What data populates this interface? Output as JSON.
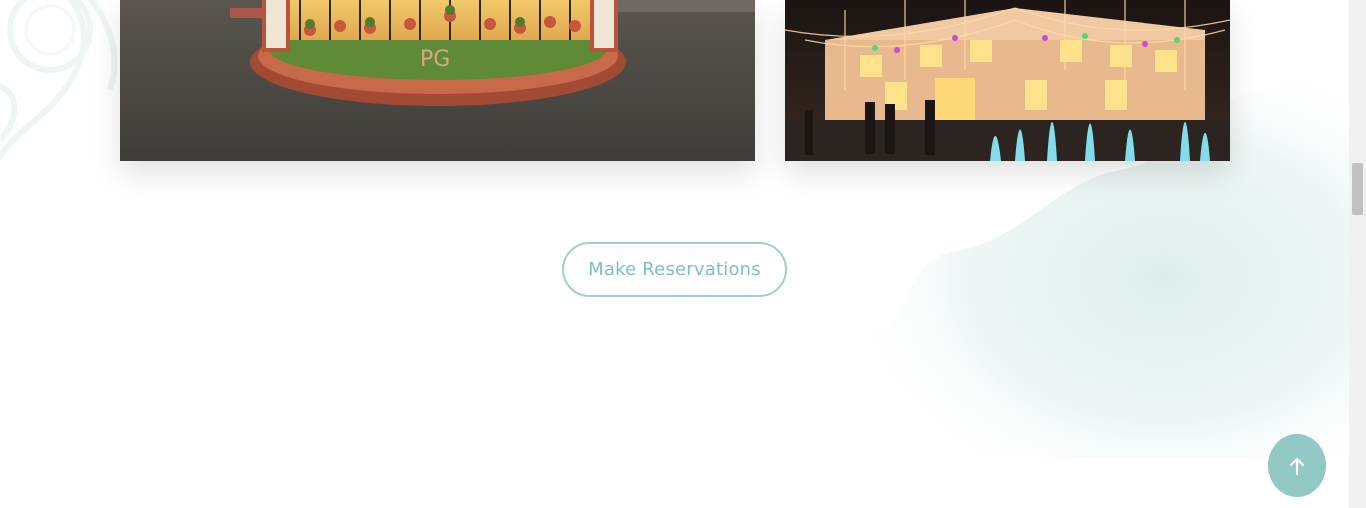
{
  "gallery": {
    "images": [
      {
        "name": "entrance-garden-photo",
        "caption": "PG"
      },
      {
        "name": "illuminated-building-photo"
      }
    ]
  },
  "cta": {
    "label": "Make Reservations"
  },
  "back_to_top": {
    "icon": "arrow-up-icon"
  },
  "colors": {
    "accent": "#93c9c4",
    "button_border": "#9fd0cc",
    "button_text": "#7fbfba",
    "wash": "#e6f2f1"
  }
}
